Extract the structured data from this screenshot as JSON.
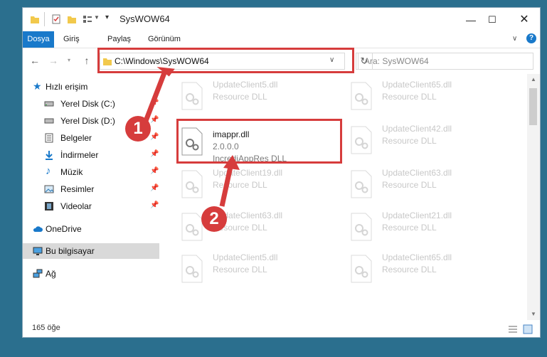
{
  "window": {
    "title": "SysWOW64"
  },
  "ribbon": {
    "tabs": [
      "Dosya",
      "Giriş",
      "Paylaş",
      "Görünüm"
    ]
  },
  "address": {
    "path": "C:\\Windows\\SysWOW64"
  },
  "search": {
    "placeholder": "Ara: SysWOW64"
  },
  "sidebar": {
    "items": [
      {
        "label": "Hızlı erişim",
        "icon": "star-icon"
      },
      {
        "label": "Yerel Disk (C:)",
        "icon": "drive-icon"
      },
      {
        "label": "Yerel Disk (D:)",
        "icon": "drive-icon"
      },
      {
        "label": "Belgeler",
        "icon": "documents-icon"
      },
      {
        "label": "İndirmeler",
        "icon": "download-icon"
      },
      {
        "label": "Müzik",
        "icon": "music-icon"
      },
      {
        "label": "Resimler",
        "icon": "pictures-icon"
      },
      {
        "label": "Videolar",
        "icon": "videos-icon"
      },
      {
        "label": "OneDrive",
        "icon": "cloud-icon"
      },
      {
        "label": "Bu bilgisayar",
        "icon": "computer-icon"
      },
      {
        "label": "Ağ",
        "icon": "network-icon"
      }
    ]
  },
  "files": [
    {
      "name": "UpdateClient5.dll",
      "type": "Resource DLL"
    },
    {
      "name": "UpdateClient65.dll",
      "type": "Resource DLL"
    },
    {
      "name": "imappr.dll",
      "version": "2.0.0.0",
      "type": "IncrediAppRes DLL"
    },
    {
      "name": "UpdateClient42.dll",
      "type": "Resource DLL"
    },
    {
      "name": "UpdateClient19.dll",
      "type": "Resource DLL"
    },
    {
      "name": "UpdateClient63.dll",
      "type": "Resource DLL"
    },
    {
      "name": "UpdateClient63.dll",
      "type": "Resource DLL"
    },
    {
      "name": "UpdateClient21.dll",
      "type": "Resource DLL"
    },
    {
      "name": "UpdateClient5.dll",
      "type": "Resource DLL"
    },
    {
      "name": "UpdateClient65.dll",
      "type": "Resource DLL"
    }
  ],
  "status": {
    "count": "165 öğe"
  },
  "annotations": {
    "step1": "1",
    "step2": "2"
  },
  "colors": {
    "accent": "#1979ca",
    "highlight": "#d63c3c",
    "desktop": "#2b6f8e"
  }
}
